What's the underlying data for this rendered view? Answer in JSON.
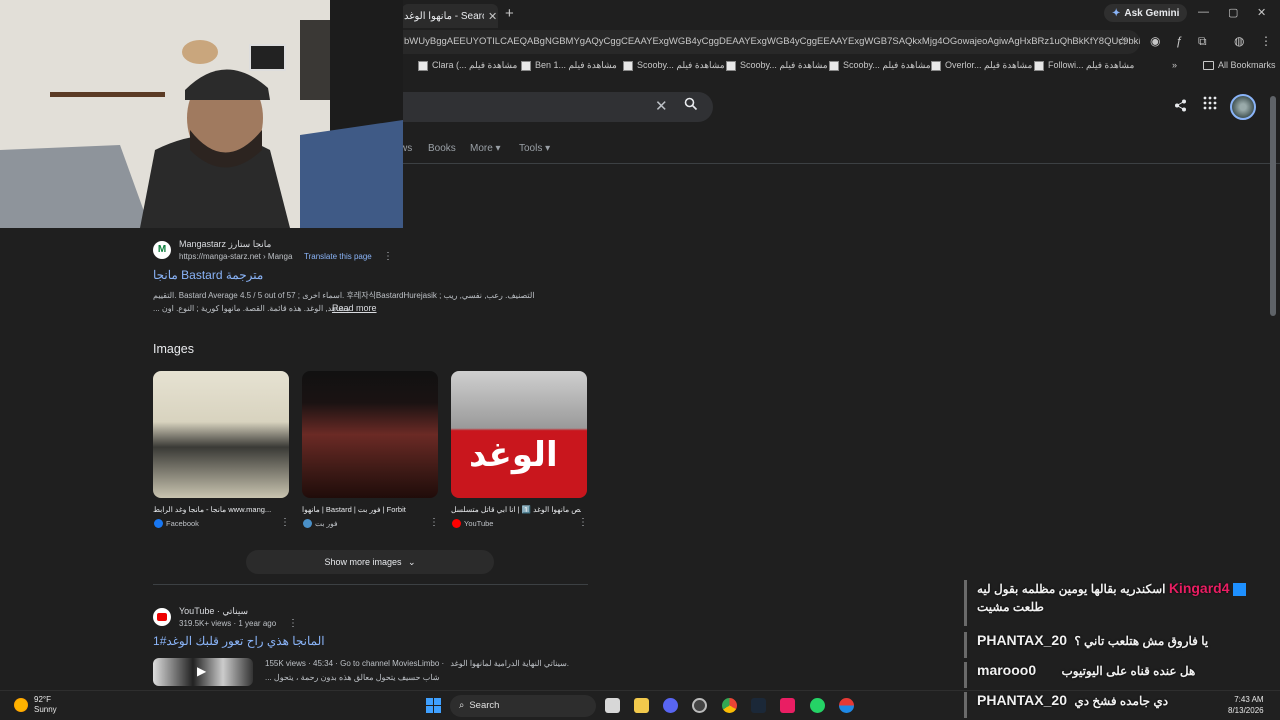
{
  "browser": {
    "tab_title": "مانهوا الوغد - Search",
    "new_tab_icon": "+",
    "ask_gemini": "Ask Gemini",
    "address": "bWUyBggAEEUYOTILCAEQABgNGBMYgAQyCggCEAAYExgWGB4yCggDEAAYExgWGB4yCggEEAAYExgWGB7SAQkxMjg4OGowajeoAgiwAgHxBRz1uQhBkKfY8QUc9bkIQZC",
    "bookmarks": [
      "Clara (... مشاهدة فيلم",
      "Ben 1... مشاهدة فيلم",
      "Scooby... مشاهدة فيلم",
      "Scooby... مشاهدة فيلم",
      "Scooby... مشاهدة فيلم",
      "Overlor... مشاهدة فيلم",
      "Followi... مشاهدة فيلم"
    ],
    "all_bookmarks": "All Bookmarks"
  },
  "search": {
    "filters": [
      "ws",
      "Books",
      "More ▾",
      "Tools ▾"
    ]
  },
  "result1": {
    "site_name": "Mangastarz مانجا ستارز",
    "url": "https://manga-starz.net › Manga",
    "translate": "Translate this page",
    "title": "مانجا Bastard مترجمة",
    "snippet1": "التقييم. Bastard Average 4.5 / 5 out of 57 ; اسماء اخرى. 후레자식BastardHurejasik ; التصنيف. رعب, نفسي, ريب",
    "snippet2": "... مشاهد, الوغد. هذه قائمة. القصة. مانهوا كورية ; النوع. اون",
    "read_more": "Read more"
  },
  "images": {
    "heading": "Images",
    "items": [
      {
        "caption": "مانجا - مانجا وغد الرابط www.mang...",
        "source": "Facebook",
        "color": "#1877f2"
      },
      {
        "caption": "مانهوا | Bastard | فور بت | Forbit",
        "source": "فور بت",
        "color": "#4a90c8"
      },
      {
        "caption": "ملخص مانهوا الوغد 1️⃣ | انا ابي قاتل متسلسل...",
        "source": "YouTube",
        "color": "#ff0000"
      }
    ],
    "thumb3_text": "الوغد",
    "show_more": "Show more images"
  },
  "result2": {
    "site_name": "YouTube · سيناتي",
    "meta": "319.5K+ views · 1 year ago",
    "title": "المانجا هذي راح تعور قلبك الوغد#1",
    "video_meta": "155K views · 45:34 · Go to channel MoviesLimbo · سيناتي",
    "video_desc1": "النهاية الدرامية لمانهوا الوغد.",
    "video_desc2": "... شاب حسيف يتحول معالق هذه بدون رحمة ، يتحول"
  },
  "chat": [
    {
      "name": "Kingard4",
      "name_color": "#e91e63",
      "text": "اسكندريه بقالها يومين مظلمه بقول ليه",
      "text2": "طلعت مشيت"
    },
    {
      "name": "PHANTAX_20",
      "name_color": "#f1f1f1",
      "text": "يا فاروق مش هتلعب تاني ؟"
    },
    {
      "name": "marooo0",
      "name_color": "#f1f1f1",
      "text": "هل عنده قناه على اليوتيوب"
    },
    {
      "name": "PHANTAX_20",
      "name_color": "#f1f1f1",
      "text": "دي جامده فشخ دي"
    }
  ],
  "taskbar": {
    "temperature": "92°F",
    "weather": "Sunny",
    "search": "Search",
    "time": "7:43 AM",
    "date": "8/13/2026"
  }
}
